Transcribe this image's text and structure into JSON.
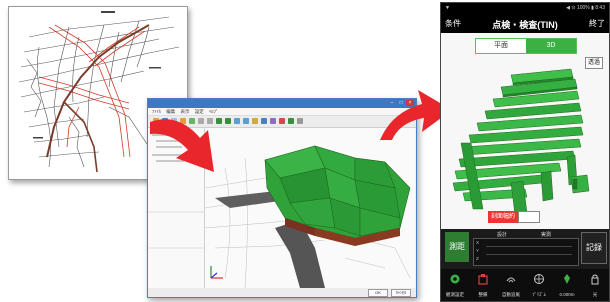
{
  "colors": {
    "phone_accent": "#3cb043",
    "arrow": "#e8262c",
    "window_title": "#3d78c8",
    "tin_green": "#2fa33a"
  },
  "desktop": {
    "window_title": "",
    "menu_items": [
      "ﾌｧｲﾙ",
      "編集",
      "表示",
      "設定",
      "ﾍﾙﾌﾟ"
    ],
    "status_buttons": [
      "OK",
      "ｷｬﾝｾﾙ"
    ]
  },
  "phone": {
    "statusbar_left": "▼",
    "statusbar_right": "◀ ⊙ 100% ▮ 8:43",
    "header": {
      "left_button": "条件",
      "title": "点検・検査(TIN)",
      "right_button": "終了"
    },
    "view_tabs": [
      {
        "label": "平面",
        "active": false
      },
      {
        "label": "3D",
        "active": true
      }
    ],
    "tag_top": "透過",
    "tag_red": "刻面幅約",
    "measure_button": "測距",
    "record_button": "記録",
    "table_headers": [
      "設計",
      "実測"
    ],
    "table_rows": [
      "X",
      "Y",
      "Z"
    ],
    "bottom_nav": [
      {
        "icon": "gear-icon",
        "label": "観測設定",
        "color": "#3cb043"
      },
      {
        "icon": "building-icon",
        "label": "整備",
        "color": "#e33b3b"
      },
      {
        "icon": "wave-icon",
        "label": "自動追尾",
        "color": "#aaaaaa"
      },
      {
        "icon": "target-icon",
        "label": "ﾌﾟﾘｽﾞﾑ",
        "color": "#cccccc"
      },
      {
        "icon": "pin-icon",
        "label": "0.000m",
        "color": "#3cb043"
      },
      {
        "icon": "lock-icon",
        "label": "光",
        "color": "#cccccc"
      }
    ]
  }
}
